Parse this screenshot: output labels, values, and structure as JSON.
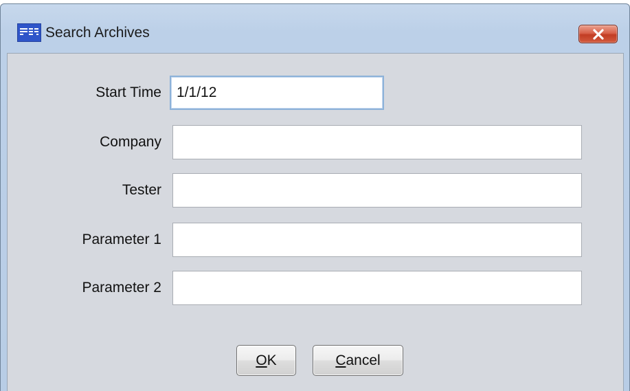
{
  "window": {
    "title": "Search Archives",
    "app_icon": "app-logo-icon",
    "close_icon": "close-icon"
  },
  "form": {
    "fields": [
      {
        "label": "Start Time",
        "value": "1/1/12",
        "placeholder": ""
      },
      {
        "label": "Company",
        "value": "",
        "placeholder": ""
      },
      {
        "label": "Tester",
        "value": "",
        "placeholder": ""
      },
      {
        "label": "Parameter 1",
        "value": "",
        "placeholder": ""
      },
      {
        "label": "Parameter 2",
        "value": "",
        "placeholder": ""
      }
    ]
  },
  "buttons": {
    "ok_mnemonic": "O",
    "ok_rest": "K",
    "cancel_mnemonic": "C",
    "cancel_rest": "ancel"
  },
  "colors": {
    "title_bar": "#bcd0e8",
    "client_background": "#d6d9df",
    "close_button": "#c94a32",
    "focus_border": "#8db2d9"
  }
}
